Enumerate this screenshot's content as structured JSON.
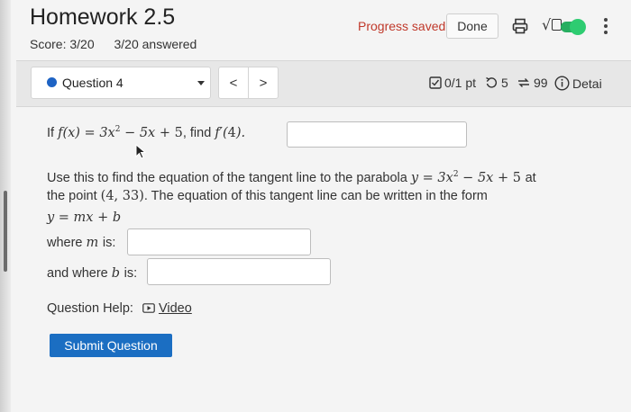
{
  "header": {
    "title": "Homework 2.5",
    "score": "Score: 3/20",
    "answered": "3/20 answered",
    "progress_status": "Progress saved",
    "done_label": "Done"
  },
  "question_nav": {
    "selected_question": "Question 4",
    "prev_label": "<",
    "next_label": ">",
    "points": "0/1 pt",
    "retries": "5",
    "attempts": "99",
    "details_label": "Detai"
  },
  "question": {
    "prompt_if": "If",
    "prompt_find": ", find",
    "line1": "Use this to find the equation of the tangent line to the parabola",
    "line1_at": "at",
    "line2_start": "the point",
    "line2_end": ". The equation of this tangent line can be written in the form",
    "where_m": "is:",
    "where_m_prefix": "where",
    "where_b_prefix": "and where",
    "where_b": "is:",
    "help_label": "Question Help:",
    "video_label": "Video",
    "submit_label": "Submit Question"
  },
  "answers": {
    "derivative_value": "",
    "slope_m": "",
    "intercept_b": ""
  },
  "colors": {
    "progress_red": "#c0392b",
    "submit_blue": "#1b6ec2",
    "question_dot": "#1e63c4",
    "toggle_green": "#2ecc71"
  },
  "icons": [
    "print-icon",
    "square-root-icon",
    "toggle-icon",
    "kebab-menu-icon",
    "checkbox-icon",
    "retry-icon",
    "attempts-icon",
    "info-icon",
    "video-icon",
    "mouse-cursor-icon"
  ]
}
